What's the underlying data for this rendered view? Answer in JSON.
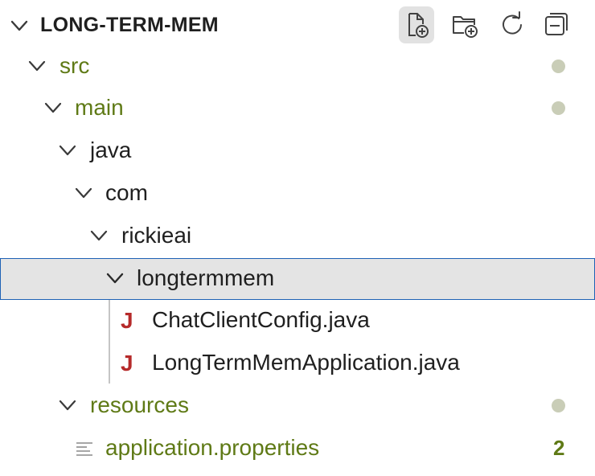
{
  "explorer": {
    "title": "LONG-TERM-MEM",
    "toolbar": {
      "new_file_icon": "new-file-icon",
      "new_folder_icon": "new-folder-icon",
      "refresh_icon": "refresh-icon",
      "collapse_icon": "collapse-all-icon"
    }
  },
  "tree": {
    "src": "src",
    "main": "main",
    "java": "java",
    "com": "com",
    "rickieai": "rickieai",
    "longtermmem": "longtermmem",
    "file1": "ChatClientConfig.java",
    "file2": "LongTermMemApplication.java",
    "resources": "resources",
    "props": "application.properties",
    "props_count": "2",
    "java_badge": "J"
  },
  "colors": {
    "modified": "#5f7a16",
    "selection_border": "#1f62b5",
    "selection_bg": "#e4e4e4",
    "java_icon": "#b62a2a"
  }
}
